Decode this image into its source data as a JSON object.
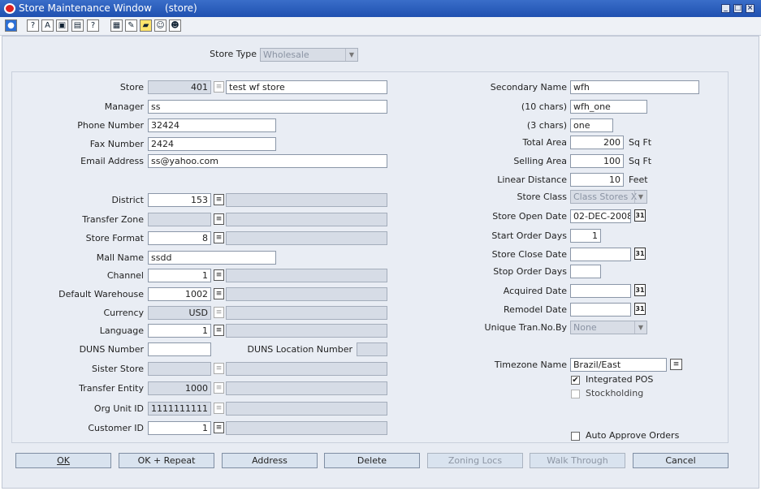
{
  "window": {
    "title": "Store Maintenance Window",
    "context": "(store)"
  },
  "toolbar": {
    "icons": [
      "globe-icon",
      "help-icon",
      "find-icon",
      "copy-icon",
      "print-icon",
      "info-icon",
      "grid-icon",
      "edit-icon",
      "folder-icon",
      "user-icon",
      "user-alt-icon"
    ]
  },
  "store_type": {
    "label": "Store Type",
    "value": "Wholesale"
  },
  "left": {
    "store_label": "Store",
    "store_id": "401",
    "store_name": "test wf store",
    "manager_label": "Manager",
    "manager": "ss",
    "phone_label": "Phone Number",
    "phone": "32424",
    "fax_label": "Fax Number",
    "fax": "2424",
    "email_label": "Email Address",
    "email": "ss@yahoo.com",
    "district_label": "District",
    "district": "153",
    "transfer_zone_label": "Transfer Zone",
    "store_format_label": "Store Format",
    "store_format": "8",
    "mall_label": "Mall Name",
    "mall": "ssdd",
    "channel_label": "Channel",
    "channel": "1",
    "default_wh_label": "Default Warehouse",
    "default_wh": "1002",
    "currency_label": "Currency",
    "currency": "USD",
    "language_label": "Language",
    "language": "1",
    "duns_label": "DUNS Number",
    "duns_loc_label": "DUNS Location Number",
    "sister_label": "Sister Store",
    "transfer_entity_label": "Transfer Entity",
    "transfer_entity": "1000",
    "org_unit_label": "Org Unit ID",
    "org_unit": "1111111111",
    "customer_label": "Customer ID",
    "customer": "1"
  },
  "right": {
    "secondary_label": "Secondary Name",
    "secondary": "wfh",
    "ten_label": "(10 chars)",
    "ten": "wfh_one",
    "three_label": "(3 chars)",
    "three": "one",
    "total_area_label": "Total Area",
    "total_area": "200",
    "sqft": "Sq Ft",
    "selling_area_label": "Selling Area",
    "selling_area": "100",
    "linear_label": "Linear Distance",
    "linear": "10",
    "feet": "Feet",
    "class_label": "Store Class",
    "class_value": "Class Stores X",
    "open_date_label": "Store Open Date",
    "open_date": "02-DEC-2008",
    "start_order_label": "Start Order Days",
    "start_order": "1",
    "close_date_label": "Store Close Date",
    "stop_order_label": "Stop Order Days",
    "acquired_label": "Acquired Date",
    "remodel_label": "Remodel Date",
    "tran_label": "Unique Tran.No.By",
    "tran_value": "None",
    "tz_label": "Timezone Name",
    "tz": "Brazil/East",
    "integrated_pos": "Integrated POS",
    "stockholding": "Stockholding",
    "auto_approve": "Auto Approve Orders"
  },
  "buttons": {
    "ok": "OK",
    "ok_repeat": "OK + Repeat",
    "address": "Address",
    "delete": "Delete",
    "zoning": "Zoning Locs",
    "walk": "Walk Through",
    "cancel": "Cancel"
  }
}
